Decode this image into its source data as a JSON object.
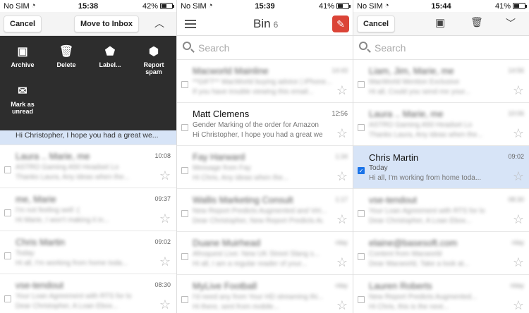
{
  "statusbars": [
    {
      "carrier": "No SIM",
      "time": "15:38",
      "battery": "42%",
      "battery_fraction": 0.42
    },
    {
      "carrier": "No SIM",
      "time": "15:39",
      "battery": "41%",
      "battery_fraction": 0.41
    },
    {
      "carrier": "No SIM",
      "time": "15:44",
      "battery": "41%",
      "battery_fraction": 0.41
    }
  ],
  "panel1": {
    "cancel": "Cancel",
    "move_to_inbox": "Move to Inbox",
    "actions": [
      {
        "label": "Archive",
        "icon": "archive-icon"
      },
      {
        "label": "Delete",
        "icon": "trash-icon"
      },
      {
        "label": "Label...",
        "icon": "label-icon"
      },
      {
        "label": "Report spam",
        "icon": "report-spam-icon"
      },
      {
        "label": "Mark as unread",
        "icon": "mail-icon"
      }
    ],
    "selected_preview": "Hi Christopher, I hope you had a great we...",
    "rows": [
      {
        "sender": "Laura .. Marie, me",
        "count": "4",
        "time": "10:08",
        "line1": "ASTRO Gaming A50 Headset Lo",
        "line2": "Thanks Laura, Any ideas when the..."
      },
      {
        "sender": "me, Marie",
        "count": "",
        "time": "09:37",
        "line1": "I'm not feeling well :(",
        "line2": "Hi Marie, I won't making it in..."
      },
      {
        "sender": "Chris Martin",
        "count": "",
        "time": "09:02",
        "line1": "Today",
        "line2": "Hi all, I'm working from home toda..."
      },
      {
        "sender": "vse-tendout",
        "count": "",
        "time": "08:30",
        "line1": "Your Loan Agreement with RTS for lo",
        "line2": "Dear Christopher, A Loan Ebox..."
      }
    ]
  },
  "panel2": {
    "title": "Bin",
    "count": "6",
    "search_placeholder": "Search",
    "rows": [
      {
        "sender": "Macworld Mainline",
        "time": "14:43",
        "line1": "**GIFT** MacWorld buying advice | iPhone...",
        "line2": "If you have trouble viewing this email...",
        "blur": true
      },
      {
        "sender": "Matt Clemens",
        "time": "12:56",
        "line1": "Gender Marking of the order for Amazon",
        "line2": "Hi Christopher, I hope you had a great we...",
        "blur": false
      },
      {
        "sender": "Fay Harward",
        "time": "1:34",
        "line1": "Message from Fay",
        "line2": "Hi Chris, Any ideas when the...",
        "blur": true
      },
      {
        "sender": "Wallis Marketing Consult",
        "time": "1:17",
        "line1": "New Report Predicts Augmented and Virt...",
        "line2": "Dear Christopher, New Report Predicts Au...",
        "blur": true
      },
      {
        "sender": "Duane Muirhead",
        "time": "rday",
        "line1": "Afroquest Live: New UK Street Slang s...",
        "line2": "Hi all, I am a regular reader of your...",
        "blur": true
      },
      {
        "sender": "MyLive Football",
        "time": "rday",
        "line1": "I'd need any from Your HD streaming thi...",
        "line2": "Hi there, sent from mobile...",
        "blur": true
      }
    ]
  },
  "panel3": {
    "cancel": "Cancel",
    "search_placeholder": "Search",
    "rows": [
      {
        "sender": "Liam, Jim, Marie, me",
        "time": "14:56",
        "line1": "MacWorld Mention Exclusive",
        "line2": "Hi all, Could you send me your...",
        "blur": true,
        "selected": false
      },
      {
        "sender": "Laura .. Marie, me",
        "time": "10:06",
        "line1": "ASTRO Gaming A50 Headset Lo",
        "line2": "Thanks Laura, Any ideas when the...",
        "blur": true,
        "selected": false
      },
      {
        "sender": "Chris Martin",
        "time": "09:02",
        "line1": "Today",
        "line2": "Hi all, I'm working from home toda...",
        "blur": false,
        "selected": true
      },
      {
        "sender": "vse-tendout",
        "time": "08:30",
        "line1": "Your Loan Agreement with RTS for lo",
        "line2": "Dear Christopher, A Loan Ebox...",
        "blur": true,
        "selected": false
      },
      {
        "sender": "elaine@basesoft.com",
        "time": "rday",
        "line1": "Content from Macworld",
        "line2": "Dear Macworld, Take a look at...",
        "blur": true,
        "selected": false
      },
      {
        "sender": "Lauren Roberts",
        "time": "riday",
        "line1": "New Report Predicts Augmented...",
        "line2": "Hi Chris, this is the next...",
        "blur": true,
        "selected": false
      }
    ]
  }
}
